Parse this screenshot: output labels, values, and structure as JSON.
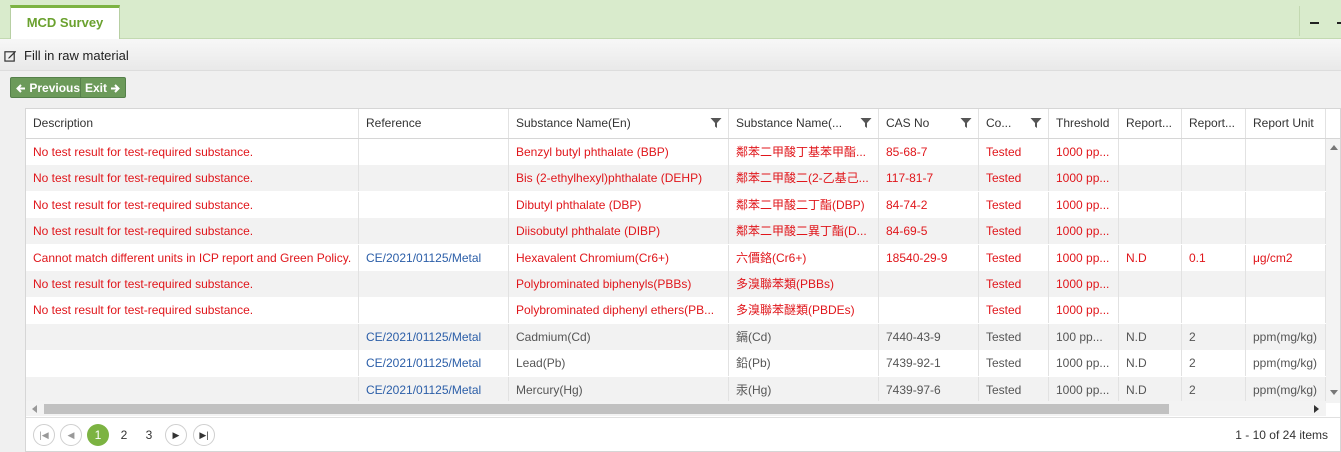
{
  "tab": {
    "label": "MCD Survey"
  },
  "subheader": {
    "title": "Fill in raw material",
    "icon": "edit-icon"
  },
  "toolbar": {
    "previous_label": "Previous",
    "exit_label": "Exit"
  },
  "columns": [
    "Description",
    "Reference",
    "Substance Name(En)",
    "Substance Name(...",
    "CAS No",
    "Co...",
    "Threshold",
    "Report...",
    "Report...",
    "Report Unit"
  ],
  "rows": [
    {
      "description": "No test result for test-required substance.",
      "reference": "",
      "name_en": "Benzyl butyl phthalate (BBP)",
      "name_zh": "鄰苯二甲酸丁基苯甲酯...",
      "cas": "85-68-7",
      "status": "Tested",
      "threshold": "1000 pp...",
      "report1": "",
      "report2": "",
      "unit": ""
    },
    {
      "description": "No test result for test-required substance.",
      "reference": "",
      "name_en": "Bis (2-ethylhexyl)phthalate (DEHP)",
      "name_zh": "鄰苯二甲酸二(2-乙基己...",
      "cas": "117-81-7",
      "status": "Tested",
      "threshold": "1000 pp...",
      "report1": "",
      "report2": "",
      "unit": ""
    },
    {
      "description": "No test result for test-required substance.",
      "reference": "",
      "name_en": "Dibutyl phthalate (DBP)",
      "name_zh": "鄰苯二甲酸二丁酯(DBP)",
      "cas": "84-74-2",
      "status": "Tested",
      "threshold": "1000 pp...",
      "report1": "",
      "report2": "",
      "unit": ""
    },
    {
      "description": "No test result for test-required substance.",
      "reference": "",
      "name_en": "Diisobutyl phthalate (DIBP)",
      "name_zh": "鄰苯二甲酸二異丁酯(D...",
      "cas": "84-69-5",
      "status": "Tested",
      "threshold": "1000 pp...",
      "report1": "",
      "report2": "",
      "unit": ""
    },
    {
      "description": "Cannot match different units in ICP report and Green Policy.",
      "reference": "CE/2021/01125/Metal",
      "name_en": "Hexavalent Chromium(Cr6+)",
      "name_zh": "六價鉻(Cr6+)",
      "cas": "18540-29-9",
      "status": "Tested",
      "threshold": "1000 pp...",
      "report1": "N.D",
      "report2": "0.1",
      "unit": "μg/cm2"
    },
    {
      "description": "No test result for test-required substance.",
      "reference": "",
      "name_en": "Polybrominated biphenyls(PBBs)",
      "name_zh": "多溴聯苯類(PBBs)",
      "cas": "",
      "status": "Tested",
      "threshold": "1000 pp...",
      "report1": "",
      "report2": "",
      "unit": ""
    },
    {
      "description": "No test result for test-required substance.",
      "reference": "",
      "name_en": "Polybrominated diphenyl ethers(PB...",
      "name_zh": "多溴聯苯醚類(PBDEs)",
      "cas": "",
      "status": "Tested",
      "threshold": "1000 pp...",
      "report1": "",
      "report2": "",
      "unit": ""
    },
    {
      "description": "",
      "reference": "CE/2021/01125/Metal",
      "name_en": "Cadmium(Cd)",
      "name_zh": "鎘(Cd)",
      "cas": "7440-43-9",
      "status": "Tested",
      "threshold": "100 pp...",
      "report1": "N.D",
      "report2": "2",
      "unit": "ppm(mg/kg)"
    },
    {
      "description": "",
      "reference": "CE/2021/01125/Metal",
      "name_en": "Lead(Pb)",
      "name_zh": "鉛(Pb)",
      "cas": "7439-92-1",
      "status": "Tested",
      "threshold": "1000 pp...",
      "report1": "N.D",
      "report2": "2",
      "unit": "ppm(mg/kg)"
    },
    {
      "description": "",
      "reference": "CE/2021/01125/Metal",
      "name_en": "Mercury(Hg)",
      "name_zh": "汞(Hg)",
      "cas": "7439-97-6",
      "status": "Tested",
      "threshold": "1000 pp...",
      "report1": "N.D",
      "report2": "2",
      "unit": "ppm(mg/kg)"
    }
  ],
  "pager": {
    "pages": [
      "1",
      "2",
      "3"
    ],
    "current": "1",
    "info": "1 - 10 of 24 items"
  },
  "colors": {
    "error_text": "#e0161b",
    "accent": "#7cb342",
    "link": "#2b5ea8"
  }
}
